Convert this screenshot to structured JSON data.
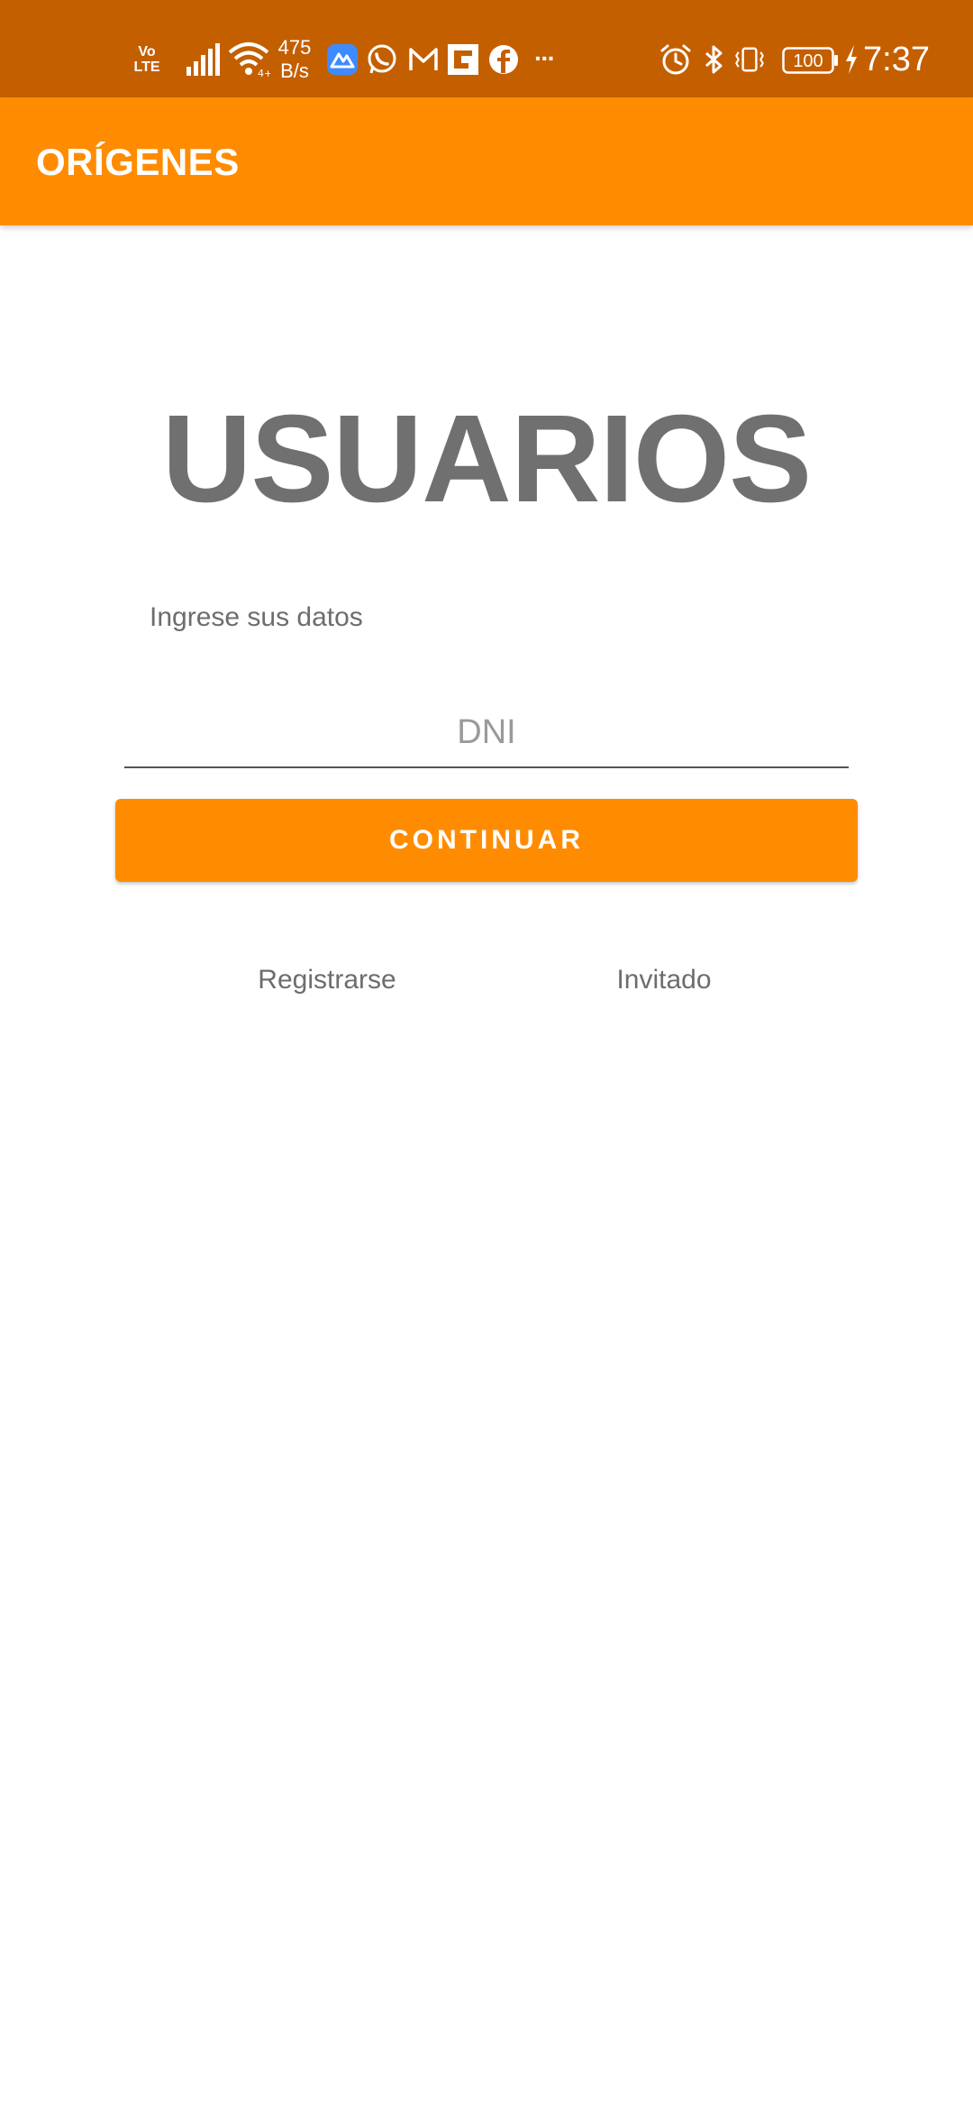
{
  "status_bar": {
    "volte_top": "Vo",
    "volte_bottom": "LTE",
    "net_speed_value": "475",
    "net_speed_unit": "B/s",
    "time": "7:37",
    "battery_level": "100",
    "background_color": "#c45f00",
    "icons": [
      "volte-icon",
      "signal-icon",
      "wifi-icon",
      "app-blue-icon",
      "whatsapp-icon",
      "gmail-icon",
      "app-square-icon",
      "facebook-icon",
      "more-icon",
      "alarm-icon",
      "bluetooth-icon",
      "vibrate-icon",
      "battery-icon",
      "charging-icon"
    ]
  },
  "app_bar": {
    "title": "ORÍGENES",
    "background_color": "#ff8c00"
  },
  "main": {
    "heading": "USUARIOS",
    "subtitle": "Ingrese sus datos",
    "dni_input": {
      "placeholder": "DNI",
      "value": ""
    },
    "continue_label": "CONTINUAR",
    "register_label": "Registrarse",
    "guest_label": "Invitado"
  },
  "colors": {
    "accent": "#ff8c00",
    "heading_text": "#707070",
    "secondary_text": "#6d6d6d"
  }
}
